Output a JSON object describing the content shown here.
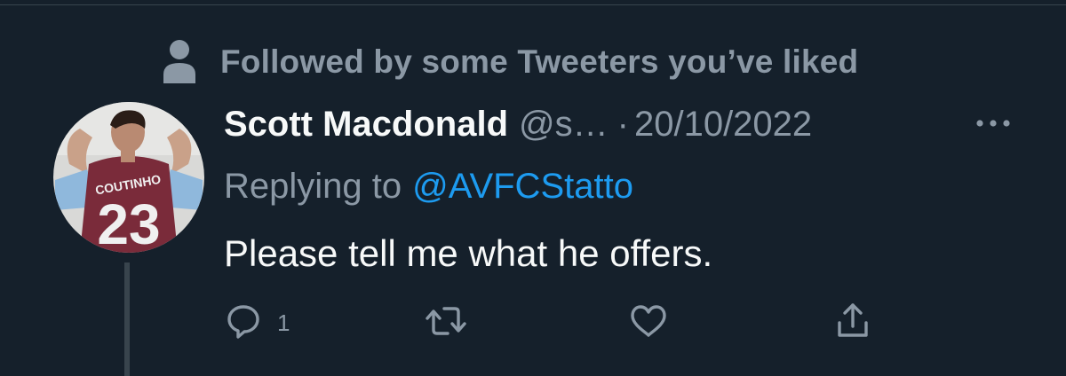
{
  "social_context": {
    "icon": "person-icon",
    "text": "Followed by some Tweeters you’ve liked"
  },
  "tweet": {
    "author_name": "Scott Macdonald",
    "handle": "@s…",
    "separator": "·",
    "timestamp": "20/10/2022",
    "more_icon": "more-horizontal-icon",
    "reply_prefix": "Replying to",
    "reply_handle": "@AVFCStatto",
    "text": "Please tell me what he offers.",
    "avatar": {
      "jersey_name": "COUTINHO",
      "jersey_number": "23"
    },
    "actions": {
      "reply_count": "1",
      "reply_icon": "reply-icon",
      "retweet_icon": "retweet-icon",
      "like_icon": "like-icon",
      "share_icon": "share-icon"
    }
  },
  "colors": {
    "background": "#15202b",
    "primary_text": "#f7f9f9",
    "secondary_text": "#8b98a5",
    "link": "#1d9bf0",
    "divider": "#38444d"
  }
}
